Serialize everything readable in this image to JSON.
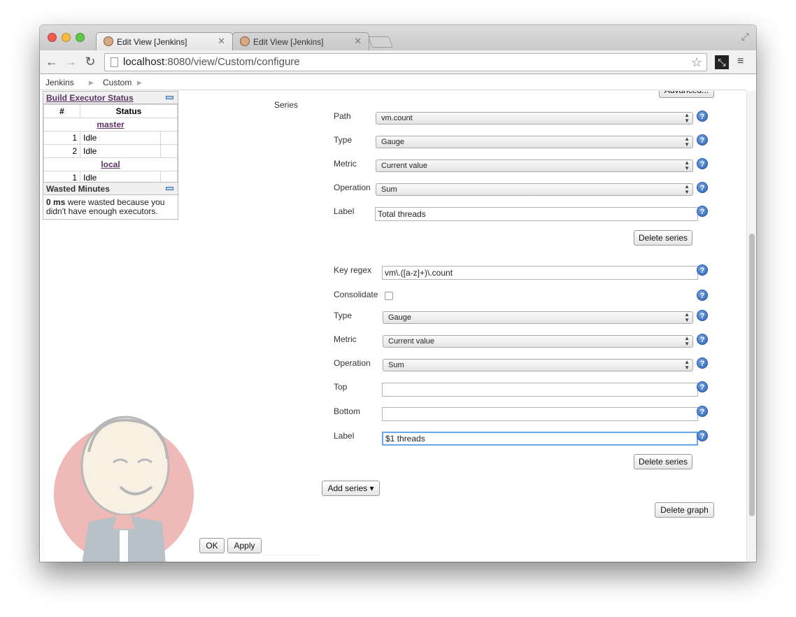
{
  "browser": {
    "tabs": [
      {
        "title": "Edit View [Jenkins]"
      },
      {
        "title": "Edit View [Jenkins]"
      }
    ],
    "url_host": "localhost",
    "url_rest": ":8080/view/Custom/configure"
  },
  "breadcrumb": {
    "items": [
      "Jenkins",
      "Custom"
    ]
  },
  "sidebar": {
    "executors": {
      "title": "Build Executor Status",
      "col_num": "#",
      "col_status": "Status",
      "master": "master",
      "master_rows": [
        {
          "num": "1",
          "status": "Idle"
        },
        {
          "num": "2",
          "status": "Idle"
        }
      ],
      "local": "local",
      "local_rows": [
        {
          "num": "1",
          "status": "Idle"
        }
      ]
    },
    "wasted": {
      "title": "Wasted Minutes",
      "bold": "0 ms",
      "text": " were wasted because you didn't have enough executors."
    }
  },
  "form": {
    "advanced_label": "Advanced...",
    "series_label": "Series",
    "series1": {
      "path_label": "Path",
      "path_value": "vm.count",
      "type_label": "Type",
      "type_value": "Gauge",
      "metric_label": "Metric",
      "metric_value": "Current value",
      "operation_label": "Operation",
      "operation_value": "Sum",
      "label_label": "Label",
      "label_value": "Total threads",
      "delete_label": "Delete series"
    },
    "series2": {
      "keyregex_label": "Key regex",
      "keyregex_value": "vm\\.([a-z]+)\\.count",
      "consolidate_label": "Consolidate",
      "type_label": "Type",
      "type_value": "Gauge",
      "metric_label": "Metric",
      "metric_value": "Current value",
      "operation_label": "Operation",
      "operation_value": "Sum",
      "top_label": "Top",
      "top_value": "",
      "bottom_label": "Bottom",
      "bottom_value": "",
      "label_label": "Label",
      "label_value": "$1 threads",
      "delete_label": "Delete series"
    },
    "add_series_label": "Add series ▾",
    "delete_graph_label": "Delete graph",
    "ok_label": "OK",
    "apply_label": "Apply",
    "help_glyph": "?"
  }
}
